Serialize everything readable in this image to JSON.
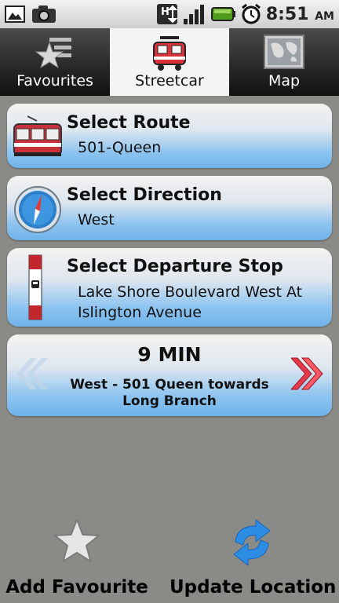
{
  "status_bar": {
    "time": "8:51",
    "ampm": "AM",
    "icons": [
      "gallery-icon",
      "camera-icon",
      "data-transfer-icon",
      "signal-icon",
      "battery-icon",
      "alarm-icon"
    ]
  },
  "tabs": [
    {
      "label": "Favourites",
      "icon": "star-list-icon",
      "active": false
    },
    {
      "label": "Streetcar",
      "icon": "streetcar-icon",
      "active": true
    },
    {
      "label": "Map",
      "icon": "map-icon",
      "active": false
    }
  ],
  "route": {
    "title": "Select Route",
    "value": "501-Queen",
    "icon": "streetcar-icon"
  },
  "direction": {
    "title": "Select Direction",
    "value": "West",
    "icon": "compass-icon"
  },
  "stop": {
    "title": "Select Departure Stop",
    "value_line1": "Lake Shore Boulevard West At",
    "value_line2": "Islington Avenue",
    "icon": "stop-pole-icon"
  },
  "prediction": {
    "eta": "9 MIN",
    "description": "West - 501 Queen towards Long Branch"
  },
  "actions": {
    "add_favourite": "Add Favourite",
    "update_location": "Update Location"
  },
  "colors": {
    "card_top": "#f3f3f0",
    "card_bottom": "#6fb3ea",
    "accent_red": "#d8323a",
    "background": "#8a8a86"
  }
}
